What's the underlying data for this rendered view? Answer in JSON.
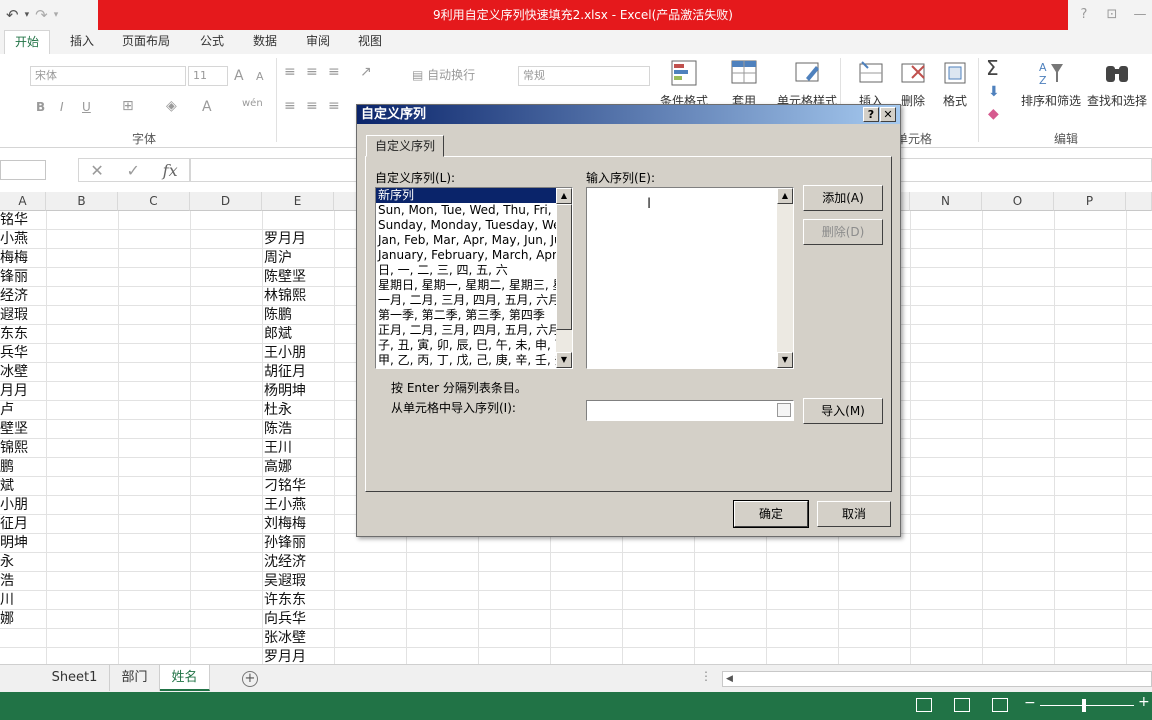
{
  "window": {
    "title": "9利用自定义序列快速填充2.xlsx -  Excel(产品激活失败)",
    "help_glyph": "?",
    "ribbon_display_glyph": "⊡",
    "minimize_glyph": "—"
  },
  "qat": {
    "undo_glyph": "↶",
    "redo_glyph": "↷"
  },
  "tabs": [
    "开始",
    "插入",
    "页面布局",
    "公式",
    "数据",
    "审阅",
    "视图"
  ],
  "ribbon": {
    "font_name": "宋体",
    "font_size": "11",
    "grow_font": "A",
    "shrink_font": "A",
    "bold": "B",
    "italic": "I",
    "underline": "U",
    "font_color": "A",
    "phonetic": "wén",
    "wrap_text": "自动换行",
    "number_format": "常规",
    "conditional_format": "条件格式",
    "table_style": "套用",
    "cell_style": "单元格样式",
    "insert": "插入",
    "delete": "删除",
    "format": "格式",
    "sum_glyph": "Σ",
    "sort_filter": "排序和筛选",
    "find_select": "查找和选择",
    "group_font": "字体",
    "group_cells": "单元格",
    "group_edit": "编辑"
  },
  "formula_bar": {
    "cancel_glyph": "✕",
    "enter_glyph": "✓",
    "fx": "fx"
  },
  "columns": [
    "A",
    "B",
    "C",
    "D",
    "E",
    "N",
    "O",
    "P"
  ],
  "rows": [
    {
      "a": "铭华",
      "e": ""
    },
    {
      "a": "小燕",
      "e": "罗月月"
    },
    {
      "a": "梅梅",
      "e": "周沪"
    },
    {
      "a": "锋丽",
      "e": "陈壁坚"
    },
    {
      "a": "经济",
      "e": "林锦熙"
    },
    {
      "a": "遐瑕",
      "e": "陈鹏"
    },
    {
      "a": "东东",
      "e": "郎斌"
    },
    {
      "a": "兵华",
      "e": "王小朋"
    },
    {
      "a": "冰壁",
      "e": "胡征月"
    },
    {
      "a": "月月",
      "e": "杨明坤"
    },
    {
      "a": "卢",
      "e": "杜永"
    },
    {
      "a": "壁坚",
      "e": "陈浩"
    },
    {
      "a": "锦熙",
      "e": "王川"
    },
    {
      "a": "鹏",
      "e": "高娜"
    },
    {
      "a": "斌",
      "e": "刁铭华"
    },
    {
      "a": "小朋",
      "e": "王小燕"
    },
    {
      "a": "征月",
      "e": "刘梅梅"
    },
    {
      "a": "明坤",
      "e": "孙锋丽"
    },
    {
      "a": "永",
      "e": "沈经济"
    },
    {
      "a": "浩",
      "e": "吴遐瑕"
    },
    {
      "a": "川",
      "e": "许东东"
    },
    {
      "a": "娜",
      "e": "向兵华"
    },
    {
      "a": "",
      "e": "张冰壁"
    },
    {
      "a": "",
      "e": "罗月月"
    }
  ],
  "sheets": [
    "Sheet1",
    "部门",
    "姓名"
  ],
  "dialog": {
    "title": "自定义序列",
    "help_glyph": "?",
    "close_glyph": "✕",
    "tab": "自定义序列",
    "list_label": "自定义序列(L):",
    "input_label": "输入序列(E):",
    "lists": [
      "新序列",
      "Sun, Mon, Tue, Wed, Thu, Fri, Sat",
      "Sunday, Monday, Tuesday, Wednesday",
      "Jan, Feb, Mar, Apr, May, Jun, Jul",
      "January, February, March, April",
      "日, 一, 二, 三, 四, 五, 六",
      "星期日, 星期一, 星期二, 星期三, 星期四",
      "一月, 二月, 三月, 四月, 五月, 六月",
      "第一季, 第二季, 第三季, 第四季",
      "正月, 二月, 三月, 四月, 五月, 六月",
      "子, 丑, 寅, 卯, 辰, 巳, 午, 未, 申, 酉",
      "甲, 乙, 丙, 丁, 戊, 己, 庚, 辛, 壬, 癸"
    ],
    "add_button": "添加(A)",
    "delete_button": "删除(D)",
    "hint": "按 Enter 分隔列表条目。",
    "import_label": "从单元格中导入序列(I):",
    "import_button": "导入(M)",
    "ok_button": "确定",
    "cancel_button": "取消"
  },
  "colors": {
    "excel_green": "#217346",
    "title_red": "#e5191c",
    "dialog_gray": "#d4d0c8",
    "selection_blue": "#0a246a"
  }
}
